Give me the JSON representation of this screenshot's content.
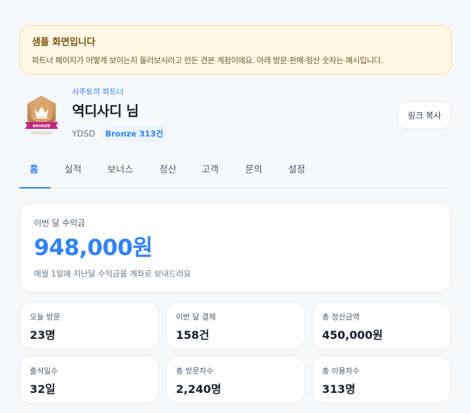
{
  "notice": {
    "title": "샘플 화면입니다",
    "text": "파트너 페이지가 어떻게 보이는지 둘러보시라고 만든 견본 계정이에요. 아래 방문·판매·정산 숫자는 예시입니다."
  },
  "profile": {
    "partner_label": "사주토끼 파트너",
    "name": "역디사디 님",
    "id": "YDSD",
    "tier": "Bronze 313건",
    "badge_text": "BRONZE",
    "copy_button": "링크 복사"
  },
  "tabs": [
    {
      "label": "홈",
      "active": true
    },
    {
      "label": "실적"
    },
    {
      "label": "보너스"
    },
    {
      "label": "정산"
    },
    {
      "label": "고객"
    },
    {
      "label": "문의"
    },
    {
      "label": "설정"
    }
  ],
  "earnings": {
    "label": "이번 달 수익금",
    "amount": "948,000원",
    "note": "매월 1일에 지난달 수익금을 계좌로 보내드려요"
  },
  "stats": [
    {
      "label": "오늘 방문",
      "value": "23명"
    },
    {
      "label": "이번 달 결제",
      "value": "158건"
    },
    {
      "label": "총 정산금액",
      "value": "450,000원"
    },
    {
      "label": "출석일수",
      "value": "32일"
    },
    {
      "label": "총 방문자수",
      "value": "2,240명"
    },
    {
      "label": "총 이용자수",
      "value": "313명"
    }
  ],
  "colors": {
    "accent": "#3182f6",
    "notice_bg": "#fff8e6",
    "bronze": "#c8925a",
    "badge_ribbon": "#c0267e"
  }
}
